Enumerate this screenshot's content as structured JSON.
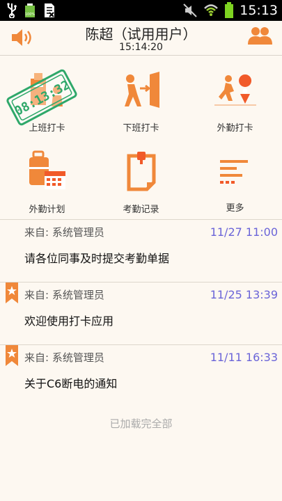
{
  "status_bar": {
    "time": "15:13",
    "icons": [
      "usb-icon",
      "battery-small-icon",
      "document-icon",
      "mute-icon",
      "wifi-icon",
      "battery-icon"
    ]
  },
  "header": {
    "title": "陈超（试用用户）",
    "clock": "15:14:20",
    "icons": [
      "speaker-icon",
      "contacts-icon"
    ]
  },
  "grid": {
    "items": [
      {
        "label": "上班打卡",
        "icon": "clock-in-icon"
      },
      {
        "label": "下班打卡",
        "icon": "clock-out-icon"
      },
      {
        "label": "外勤打卡",
        "icon": "field-checkin-icon"
      },
      {
        "label": "外勤计划",
        "icon": "field-plan-icon"
      },
      {
        "label": "考勤记录",
        "icon": "attendance-record-icon"
      },
      {
        "label": "更多",
        "icon": "more-icon"
      }
    ],
    "stamp_time": "08:13:32"
  },
  "messages": [
    {
      "from": "来自: 系统管理员",
      "time": "11/27 11:00",
      "body": "请各位同事及时提交考勤单据",
      "starred": false
    },
    {
      "from": "来自: 系统管理员",
      "time": "11/25 13:39",
      "body": "欢迎使用打卡应用",
      "starred": true
    },
    {
      "from": "来自: 系统管理员",
      "time": "11/11 16:33",
      "body": "关于C6断电的通知",
      "starred": true
    }
  ],
  "footer": {
    "loaded_text": "已加载完全部"
  },
  "colors": {
    "accent": "#f0883a",
    "time_text": "#6a64d8",
    "stamp_green": "#2fa86a"
  }
}
